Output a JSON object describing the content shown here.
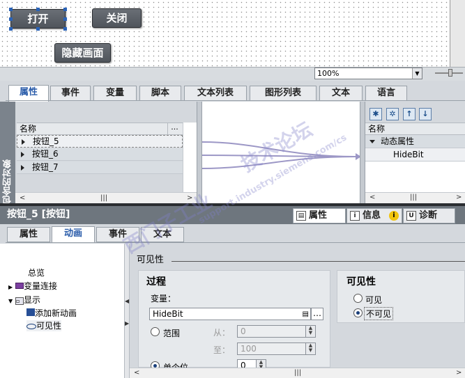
{
  "canvas": {
    "buttons": {
      "open": "打开",
      "close": "关闭",
      "hide_screen": "隐藏画面"
    },
    "zoom": "100%"
  },
  "top_tabs": [
    "属性",
    "事件",
    "变量",
    "脚本",
    "文本列表",
    "图形列表",
    "文本",
    "语言"
  ],
  "left_panel": {
    "side_label": "包含的对象",
    "header": "名称",
    "header_more": "...",
    "rows": [
      "按钮_5",
      "按钮_6",
      "按钮_7"
    ]
  },
  "right_panel": {
    "header": "名称",
    "row_group": "动态属性",
    "row_item": "HideBit"
  },
  "inspector": {
    "title": "按钮_5 [按钮]",
    "tabs": [
      "属性",
      "信息",
      "诊断"
    ],
    "sub_tabs": [
      "属性",
      "动画",
      "事件",
      "文本"
    ]
  },
  "tree": {
    "overview": "总览",
    "tag_connection": "变量连接",
    "display": "显示",
    "add_animation": "添加新动画",
    "visibility": "可见性"
  },
  "visibility_section": {
    "title": "可见性",
    "process": {
      "heading": "过程",
      "variable_label": "变量：",
      "variable_value": "HideBit",
      "range_label": "范围",
      "from_label": "从：",
      "from_value": "0",
      "to_label": "至：",
      "to_value": "100",
      "single_bit_label": "单个位",
      "single_bit_value": "0"
    },
    "visibility_box": {
      "heading": "可见性",
      "visible": "可见",
      "invisible": "不可见"
    }
  },
  "watermark": {
    "line1": "西门子工业",
    "line2": "support.industry.siemens.com/cs",
    "line3": "技术论坛"
  }
}
